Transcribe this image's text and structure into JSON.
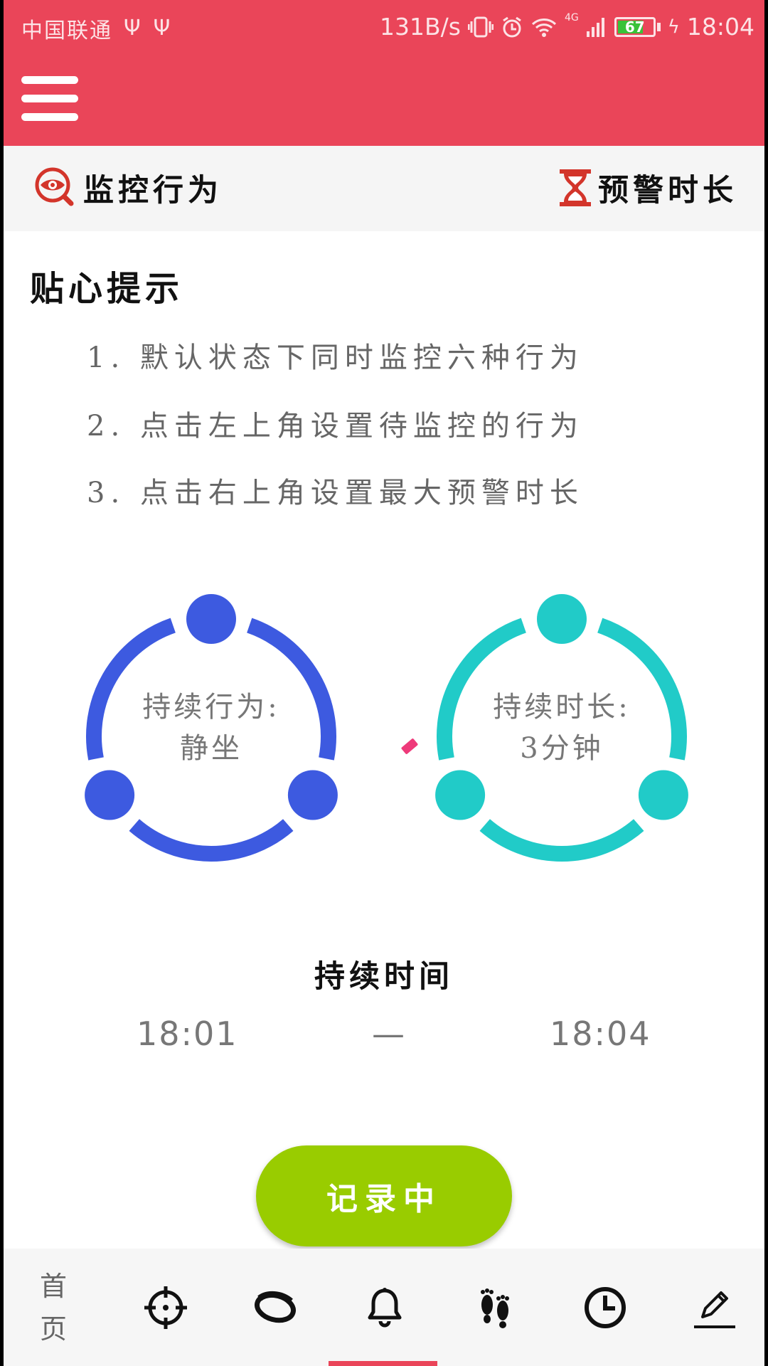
{
  "status_bar": {
    "carrier": "中国联通",
    "usb_icons": [
      "usb-icon",
      "usb-icon"
    ],
    "net_speed": "131B/s",
    "network_type": "4G",
    "battery_level": "67",
    "time": "18:04"
  },
  "header": {
    "background_color": "#ea4559",
    "menu_icon": "hamburger-menu-icon"
  },
  "settings_bar": {
    "monitor_label": "监控行为",
    "monitor_icon": "eye-search-icon",
    "warning_label": "预警时长",
    "warning_icon": "hourglass-icon"
  },
  "tips": {
    "title": "贴心提示",
    "items": [
      "1. 默认状态下同时监控六种行为",
      "2. 点击左上角设置待监控的行为",
      "3. 点击右上角设置最大预警时长"
    ]
  },
  "rings": {
    "behavior": {
      "label": "持续行为:",
      "value": "静坐",
      "color": "#3d5ae0"
    },
    "duration": {
      "label": "持续时长:",
      "value": "3分钟",
      "color": "#21cbc8"
    }
  },
  "duration_time": {
    "title": "持续时间",
    "start": "18:01",
    "dash": "—",
    "end": "18:04"
  },
  "record_button": {
    "label": "记录中",
    "color": "#99cc00"
  },
  "bottom_nav": {
    "home_label": "首页",
    "icons": [
      "crosshair-icon",
      "wristband-icon",
      "bell-icon",
      "footprints-icon",
      "clock-icon",
      "pencil-icon"
    ],
    "active_index": 3
  }
}
